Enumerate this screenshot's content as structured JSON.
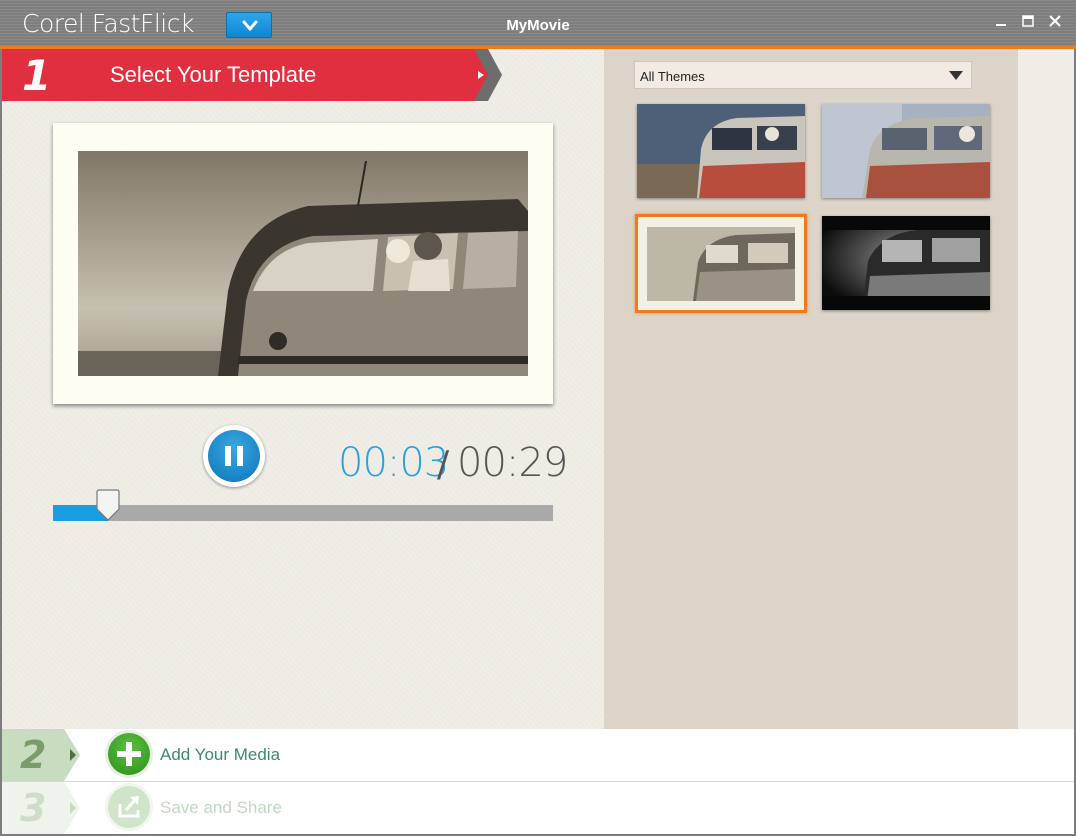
{
  "app": {
    "title": "Corel FastFlick",
    "project_name": "MyMovie"
  },
  "window_controls": [
    "minimize-icon",
    "maximize-icon",
    "close-icon"
  ],
  "step1": {
    "number": "1",
    "label": "Select Your Template"
  },
  "player": {
    "current_time": "00:03",
    "separator": "/",
    "total_time": "00:29",
    "progress_fraction": 0.11,
    "state_icon": "pause-icon"
  },
  "themes": {
    "filter_value": "All Themes",
    "selected_index": 2,
    "items": [
      {
        "style": "color"
      },
      {
        "style": "faded-dreamy"
      },
      {
        "style": "sepia-framed"
      },
      {
        "style": "dark-vignette"
      }
    ]
  },
  "step2": {
    "number": "2",
    "label": "Add Your Media",
    "icon": "plus-icon"
  },
  "step3": {
    "number": "3",
    "label": "Save and Share",
    "icon": "export-icon"
  },
  "colors": {
    "accent_orange": "#f07a20",
    "step1_red": "#e03040",
    "player_blue": "#1a9ee3",
    "step_green": "#3d8a6a"
  }
}
